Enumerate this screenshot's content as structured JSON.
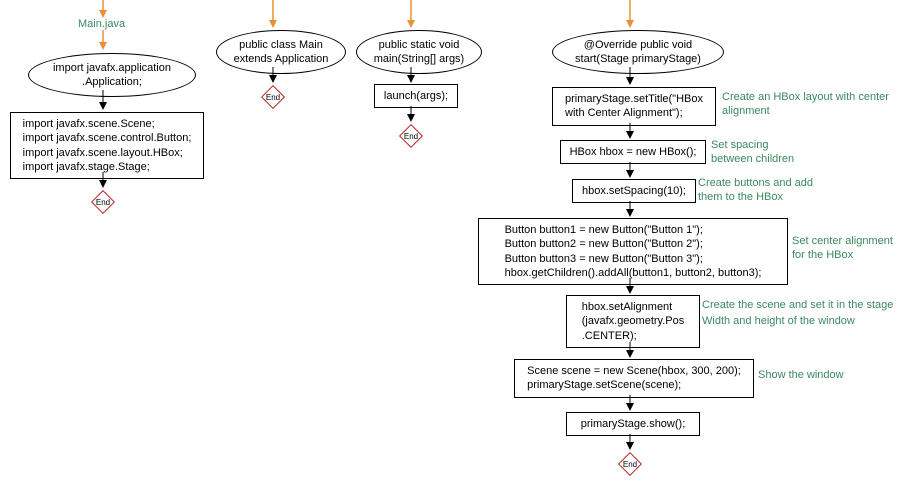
{
  "file_label": "Main.java",
  "col1": {
    "ellipse": "import javafx.application\n.Application;",
    "box": "import javafx.scene.Scene;\nimport javafx.scene.control.Button;\nimport javafx.scene.layout.HBox;\nimport javafx.stage.Stage;",
    "end": "End"
  },
  "col2": {
    "ellipse": "public class Main\nextends Application",
    "end": "End"
  },
  "col3": {
    "ellipse": "public static void\nmain(String[] args)",
    "box": "launch(args);",
    "end": "End"
  },
  "col4": {
    "ellipse": "@Override public void\nstart(Stage primaryStage)",
    "set_title": "primaryStage.setTitle(\"HBox\nwith Center Alignment\");",
    "hbox_new": "HBox hbox = new HBox();",
    "spacing": "hbox.setSpacing(10);",
    "buttons": "Button button1 = new Button(\"Button 1\");\nButton button2 = new Button(\"Button 2\");\nButton button3 = new Button(\"Button 3\");\nhbox.getChildren().addAll(button1, button2, button3);",
    "align": "hbox.setAlignment\n(javafx.geometry.Pos\n.CENTER);",
    "scene": "Scene scene = new Scene(hbox, 300, 200);\nprimaryStage.setScene(scene);",
    "show": "primaryStage.show();",
    "end": "End"
  },
  "comments": {
    "c1": "Create an HBox layout with\ncenter alignment",
    "c2": "Set spacing\nbetween children",
    "c3": "Create buttons and add\nthem to the HBox",
    "c4": "Set center alignment\nfor the HBox",
    "c5": "Create the scene and set it in the stage",
    "c6": "Width and height of the window",
    "c7": "Show the window"
  }
}
